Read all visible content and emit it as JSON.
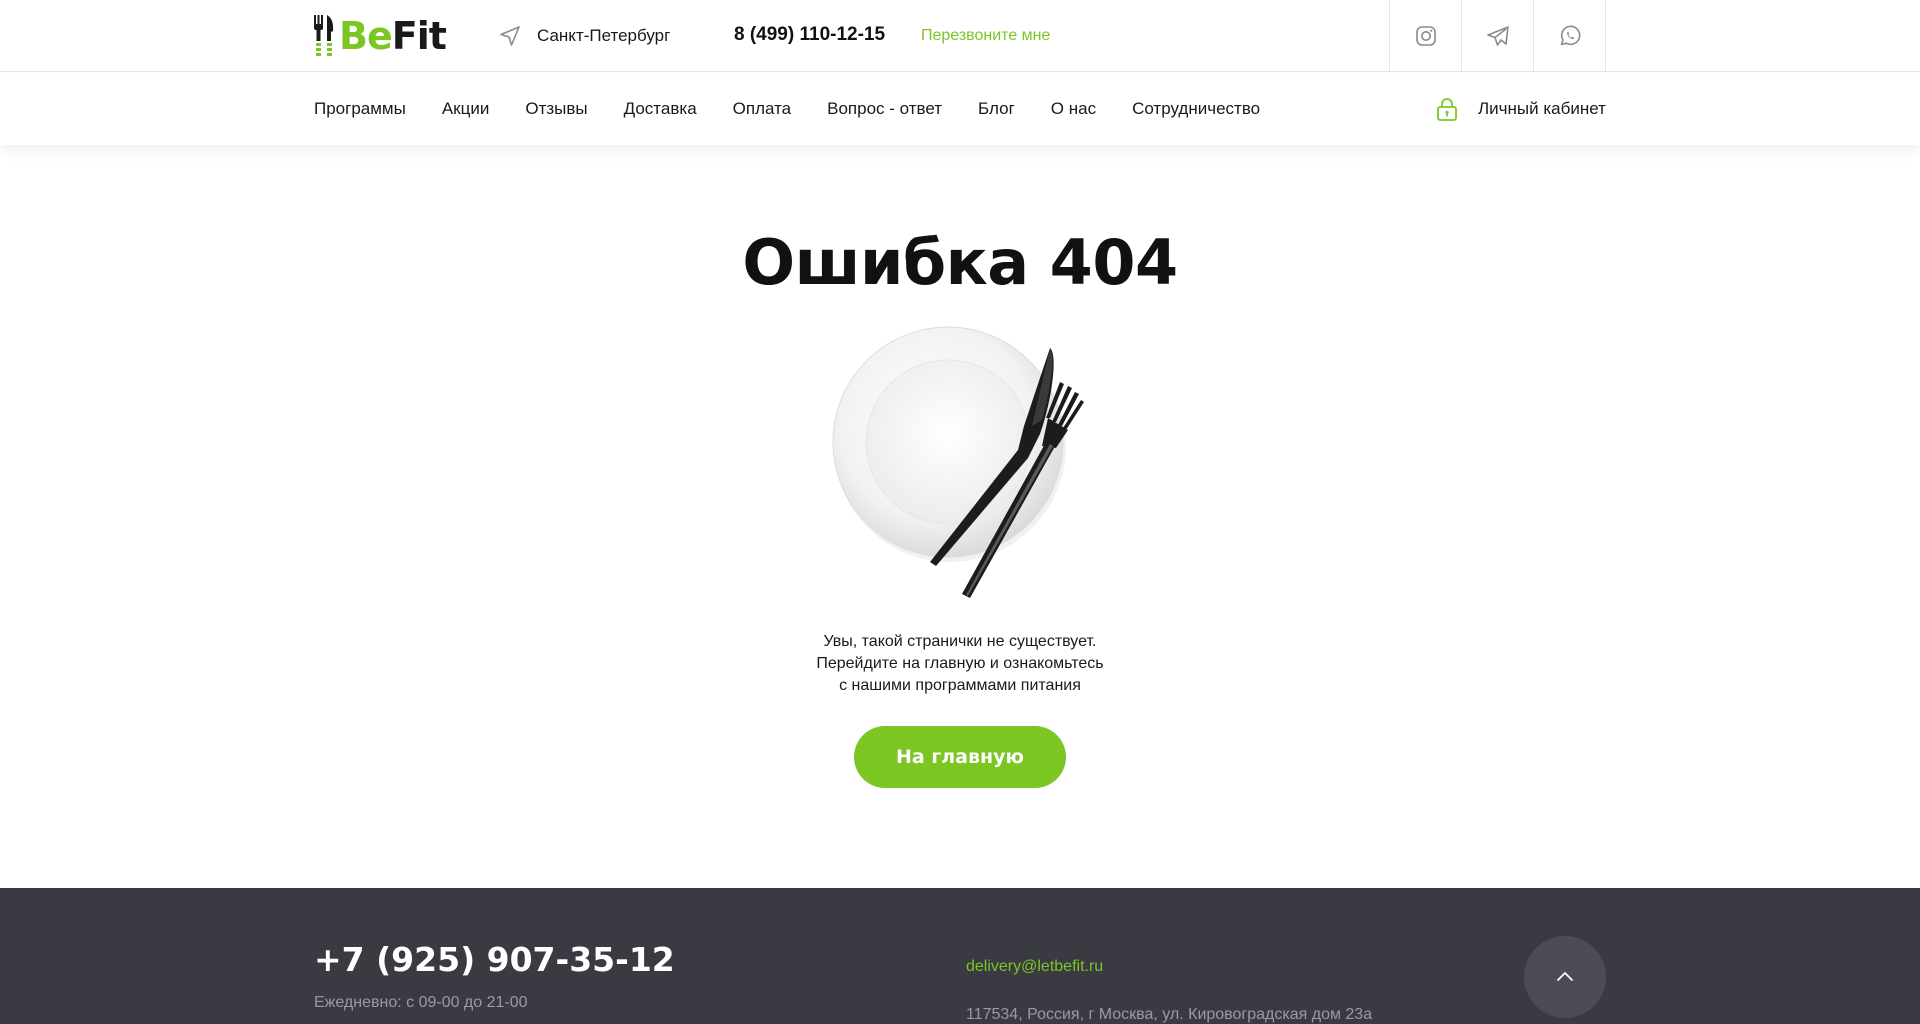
{
  "header": {
    "logo": {
      "part1": "Be",
      "part2": "Fit"
    },
    "city": "Санкт-Петербург",
    "phone": "8 (499) 110-12-15",
    "callback_label": "Перезвоните мне",
    "socials": [
      {
        "icon": "instagram-icon"
      },
      {
        "icon": "telegram-icon"
      },
      {
        "icon": "whatsapp-icon"
      }
    ]
  },
  "nav": {
    "items": [
      {
        "label": "Программы"
      },
      {
        "label": "Акции"
      },
      {
        "label": "Отзывы"
      },
      {
        "label": "Доставка"
      },
      {
        "label": "Оплата"
      },
      {
        "label": "Вопрос - ответ"
      },
      {
        "label": "Блог"
      },
      {
        "label": "О нас"
      },
      {
        "label": "Сотрудничество"
      }
    ],
    "cabinet_label": "Личный кабинет"
  },
  "main": {
    "title": "Ошибка 404",
    "message_lines": [
      "Увы, такой странички не существует.",
      "Перейдите на главную и ознакомьтесь",
      "с нашими программами питания"
    ],
    "home_button_label": "На главную"
  },
  "footer": {
    "phone": "+7 (925) 907-35-12",
    "hours": "Ежедневно: с 09-00 до 21-00",
    "email": "delivery@letbefit.ru",
    "address": "117534, Россия, г Москва, ул. Кировоградская дом 23а"
  },
  "colors": {
    "accent": "#7bc623",
    "text": "#1a1a1a",
    "footer_bg": "#3a3a42",
    "footer_muted": "#9a9aa2"
  }
}
